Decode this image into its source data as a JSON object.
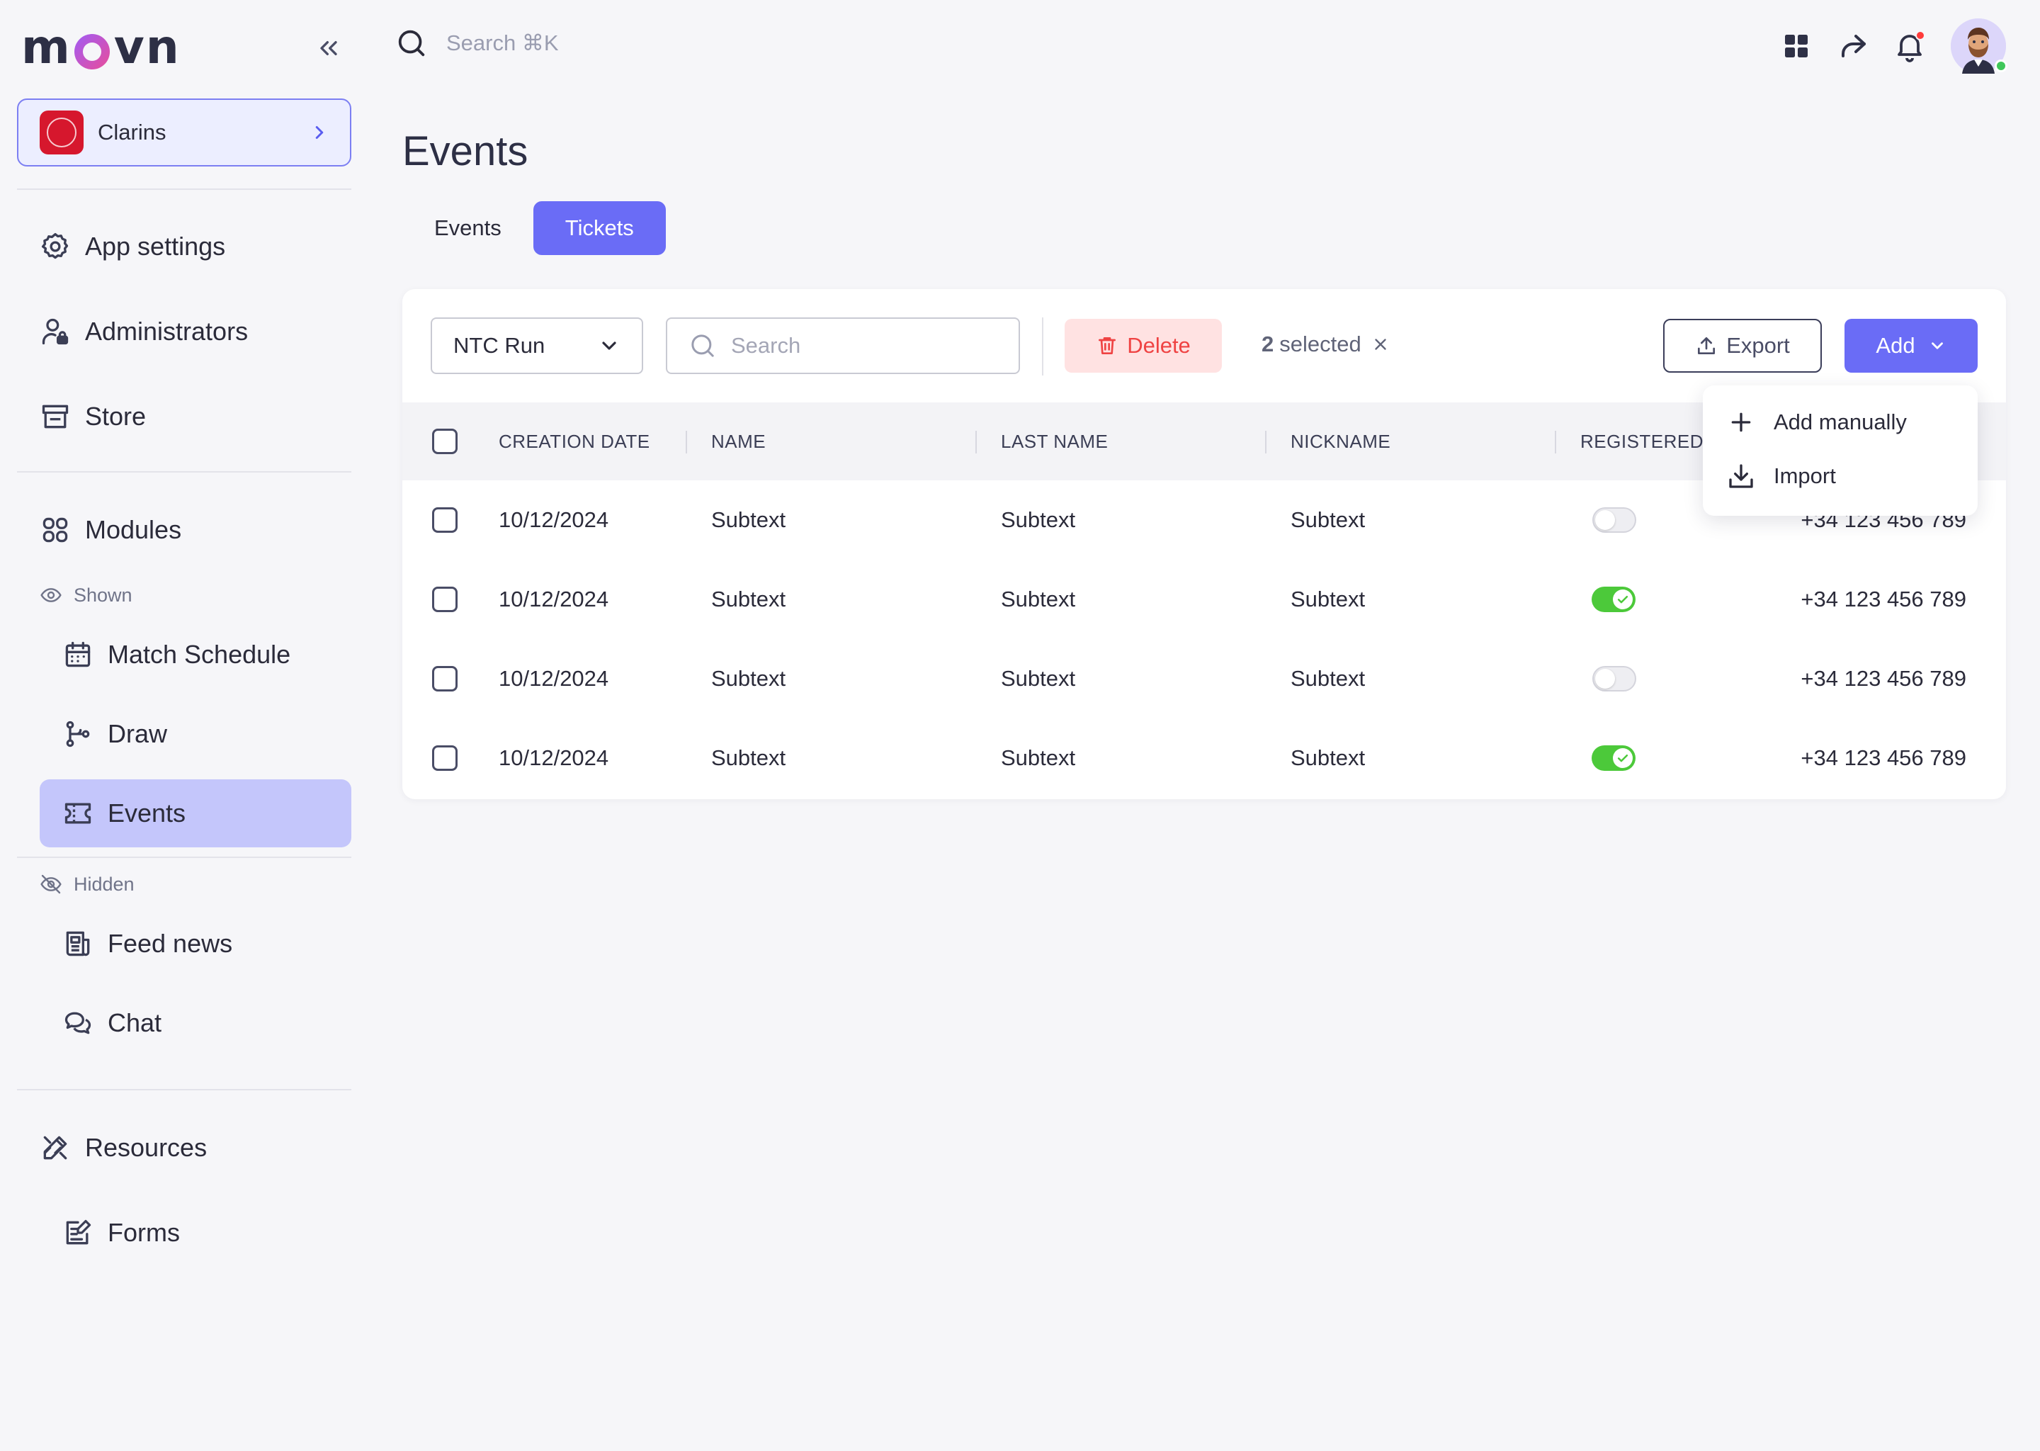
{
  "brand": {
    "logo_text_left": "m",
    "logo_text_right": "vn"
  },
  "org": {
    "name": "Clarins"
  },
  "sidebar": {
    "items_top": [
      {
        "label": "App settings",
        "icon": "gear-icon"
      },
      {
        "label": "Administrators",
        "icon": "user-lock-icon"
      },
      {
        "label": "Store",
        "icon": "store-icon"
      }
    ],
    "modules_label": "Modules",
    "shown_label": "Shown",
    "shown_items": [
      {
        "label": "Match Schedule",
        "icon": "calendar-icon"
      },
      {
        "label": "Draw",
        "icon": "bracket-icon"
      },
      {
        "label": "Events",
        "icon": "ticket-icon",
        "active": true
      }
    ],
    "hidden_label": "Hidden",
    "hidden_items": [
      {
        "label": "Feed news",
        "icon": "newspaper-icon"
      },
      {
        "label": "Chat",
        "icon": "chat-icon"
      }
    ],
    "resources_label": "Resources",
    "forms_label": "Forms"
  },
  "topbar": {
    "search_placeholder": "Search ⌘K"
  },
  "page": {
    "title": "Events",
    "tabs": [
      {
        "label": "Events",
        "active": false
      },
      {
        "label": "Tickets",
        "active": true
      }
    ]
  },
  "toolbar": {
    "event_select": "NTC Run",
    "search_placeholder": "Search",
    "delete_label": "Delete",
    "selected_count": "2",
    "selected_suffix": "selected",
    "export_label": "Export",
    "add_label": "Add"
  },
  "table": {
    "columns": [
      "CREATION DATE",
      "NAME",
      "LAST NAME",
      "NICKNAME",
      "REGISTERED"
    ],
    "rows": [
      {
        "date": "10/12/2024",
        "name": "Subtext",
        "last_name": "Subtext",
        "nickname": "Subtext",
        "registered": false,
        "phone": "+34 123 456 789"
      },
      {
        "date": "10/12/2024",
        "name": "Subtext",
        "last_name": "Subtext",
        "nickname": "Subtext",
        "registered": true,
        "phone": "+34 123 456 789"
      },
      {
        "date": "10/12/2024",
        "name": "Subtext",
        "last_name": "Subtext",
        "nickname": "Subtext",
        "registered": false,
        "phone": "+34 123 456 789"
      },
      {
        "date": "10/12/2024",
        "name": "Subtext",
        "last_name": "Subtext",
        "nickname": "Subtext",
        "registered": true,
        "phone": "+34 123 456 789"
      }
    ]
  },
  "add_menu": {
    "items": [
      {
        "label": "Add manually",
        "icon": "plus-icon"
      },
      {
        "label": "Import",
        "icon": "download-icon"
      }
    ]
  },
  "colors": {
    "accent": "#6a6cf6",
    "danger": "#ef4343",
    "success": "#4cc93a",
    "active_nav": "#c4c6fb"
  }
}
